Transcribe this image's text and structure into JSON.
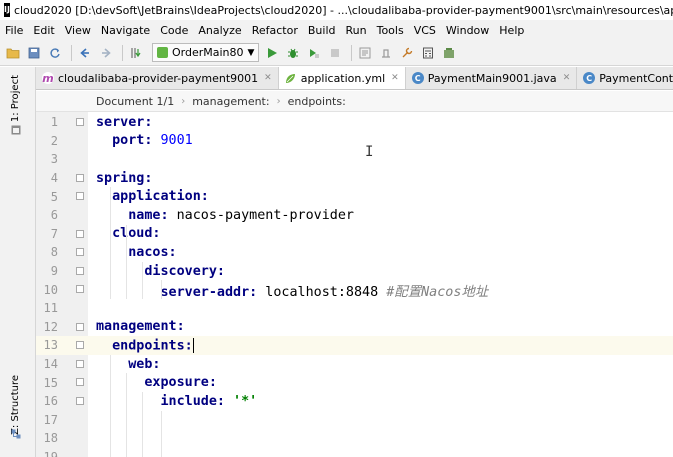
{
  "window": {
    "title": "cloud2020 [D:\\devSoft\\JetBrains\\IdeaProjects\\cloud2020] - ...\\cloudalibaba-provider-payment9001\\src\\main\\resources\\application.y"
  },
  "menu": [
    "File",
    "Edit",
    "View",
    "Navigate",
    "Code",
    "Analyze",
    "Refactor",
    "Build",
    "Run",
    "Tools",
    "VCS",
    "Window",
    "Help"
  ],
  "toolbar": {
    "run_config": "OrderMain80",
    "colors": {
      "run": "#3a9a3a",
      "debug": "#2f8f2f"
    }
  },
  "tabs": [
    {
      "label": "cloudalibaba-provider-payment9001",
      "icon": "module-icon",
      "closable": true
    },
    {
      "label": "application.yml",
      "icon": "yaml-leaf-icon",
      "closable": true,
      "active": true
    },
    {
      "label": "PaymentMain9001.java",
      "icon": "class-icon",
      "closable": true
    },
    {
      "label": "PaymentController.java",
      "icon": "class-icon",
      "closable": false
    }
  ],
  "sidebar": {
    "project_tab": "1: Project",
    "structure_tab": "Z: Structure"
  },
  "breadcrumb": [
    "Document 1/1",
    "management:",
    "endpoints:"
  ],
  "editor": {
    "current_line": 13,
    "lines": [
      {
        "num": "1",
        "indent": "",
        "key": "server:",
        "value": ""
      },
      {
        "num": "2",
        "indent": "  ",
        "key": "port:",
        "value": " 9001",
        "value_type": "number"
      },
      {
        "num": "3",
        "indent": "",
        "key": "",
        "value": ""
      },
      {
        "num": "4",
        "indent": "",
        "key": "spring:",
        "value": ""
      },
      {
        "num": "5",
        "indent": "  ",
        "key": "application:",
        "value": ""
      },
      {
        "num": "6",
        "indent": "    ",
        "key": "name:",
        "value": " nacos-payment-provider",
        "value_type": "plain"
      },
      {
        "num": "7",
        "indent": "  ",
        "key": "cloud:",
        "value": ""
      },
      {
        "num": "8",
        "indent": "    ",
        "key": "nacos:",
        "value": ""
      },
      {
        "num": "9",
        "indent": "      ",
        "key": "discovery:",
        "value": ""
      },
      {
        "num": "10",
        "indent": "        ",
        "key": "server-addr:",
        "value": " localhost:8848 ",
        "value_type": "plain",
        "comment": "#配置Nacos地址"
      },
      {
        "num": "11",
        "indent": "",
        "key": "",
        "value": ""
      },
      {
        "num": "12",
        "indent": "",
        "key": "management:",
        "value": ""
      },
      {
        "num": "13",
        "indent": "  ",
        "key": "endpoints:",
        "value": ""
      },
      {
        "num": "14",
        "indent": "    ",
        "key": "web:",
        "value": ""
      },
      {
        "num": "15",
        "indent": "      ",
        "key": "exposure:",
        "value": ""
      },
      {
        "num": "16",
        "indent": "        ",
        "key": "include:",
        "value": " '*'",
        "value_type": "string"
      },
      {
        "num": "17",
        "indent": "",
        "key": "",
        "value": ""
      },
      {
        "num": "18",
        "indent": "",
        "key": "",
        "value": ""
      },
      {
        "num": "19",
        "indent": "",
        "key": "",
        "value": ""
      }
    ]
  }
}
